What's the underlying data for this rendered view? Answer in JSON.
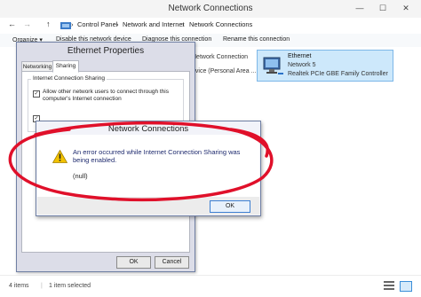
{
  "window": {
    "title": "Network Connections",
    "controls": {
      "minimize": "—",
      "maximize": "☐",
      "close": "✕"
    }
  },
  "address": {
    "back": "←",
    "forward": "→",
    "up": "↑",
    "breadcrumbs": [
      "Control Panel",
      "Network and Internet",
      "Network Connections"
    ],
    "separator": "›"
  },
  "toolbar": {
    "organize": "Organize ▾",
    "disable": "Disable this network device",
    "diagnose": "Diagnose this connection",
    "rename": "Rename this connection"
  },
  "adapters": [
    {
      "line1": "Network Connection",
      "line2": "..vice (Personal Area ..."
    },
    {
      "name": "Ethernet",
      "network": "Network  5",
      "device": "Realtek PCIe GBE Family Controller"
    }
  ],
  "properties": {
    "title": "Ethernet Properties",
    "tabs": [
      "Networking",
      "Sharing"
    ],
    "group_label": "Internet Connection Sharing",
    "option1": "Allow other network users to connect through this computer's Internet connection",
    "ok": "OK",
    "cancel": "Cancel"
  },
  "error": {
    "title": "Network Connections",
    "message": "An error occurred while Internet Connection Sharing was being enabled.",
    "detail": "(null)",
    "ok": "OK",
    "icon": "warning-icon"
  },
  "status": {
    "items": "4 items",
    "selected": "1 item selected"
  },
  "colors": {
    "annotation": "#e0102a",
    "warning": "#f2c200",
    "dialog_border": "#6f7fa3"
  }
}
